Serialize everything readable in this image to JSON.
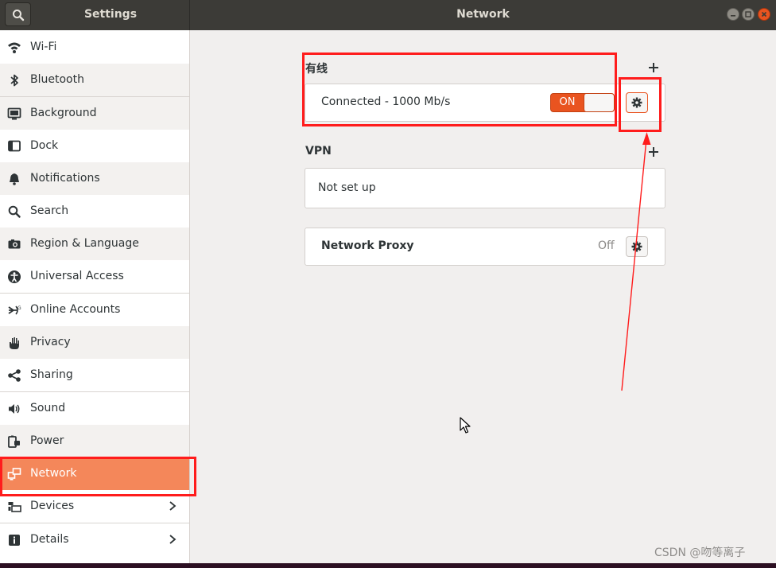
{
  "window": {
    "sidebar_title": "Settings",
    "panel_title": "Network"
  },
  "sidebar": {
    "items": [
      {
        "label": "Wi-Fi",
        "icon": "wifi-icon"
      },
      {
        "label": "Bluetooth",
        "icon": "bluetooth-icon"
      },
      {
        "label": "Background",
        "icon": "background-icon"
      },
      {
        "label": "Dock",
        "icon": "dock-icon"
      },
      {
        "label": "Notifications",
        "icon": "bell-icon"
      },
      {
        "label": "Search",
        "icon": "search-icon"
      },
      {
        "label": "Region & Language",
        "icon": "camera-icon"
      },
      {
        "label": "Universal Access",
        "icon": "accessibility-icon"
      },
      {
        "label": "Online Accounts",
        "icon": "online-accounts-icon"
      },
      {
        "label": "Privacy",
        "icon": "hand-icon"
      },
      {
        "label": "Sharing",
        "icon": "share-icon"
      },
      {
        "label": "Sound",
        "icon": "speaker-icon"
      },
      {
        "label": "Power",
        "icon": "power-plug-icon"
      },
      {
        "label": "Network",
        "icon": "network-icon",
        "active": true
      },
      {
        "label": "Devices",
        "icon": "devices-icon",
        "chevron": true
      },
      {
        "label": "Details",
        "icon": "info-icon",
        "chevron": true
      }
    ]
  },
  "wired": {
    "title": "有线",
    "status": "Connected - 1000 Mb/s",
    "toggle_label": "ON"
  },
  "vpn": {
    "title": "VPN",
    "empty_text": "Not set up"
  },
  "proxy": {
    "label": "Network Proxy",
    "status": "Off"
  },
  "watermark": "CSDN @吻等离子",
  "colors": {
    "accent": "#e95420",
    "active_item": "#f4875a",
    "annotation": "#ff1c1c"
  }
}
